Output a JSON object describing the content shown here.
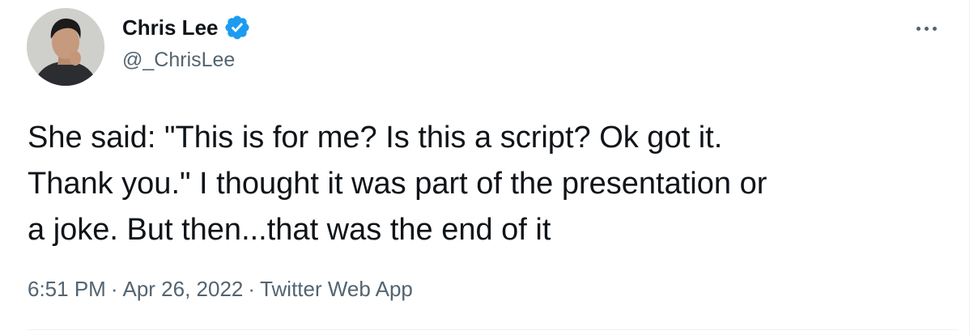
{
  "author": {
    "display_name": "Chris Lee",
    "handle": "@_ChrisLee",
    "verified": true,
    "avatar_icon": "profile-photo"
  },
  "menu": {
    "more_icon": "ellipsis-icon"
  },
  "tweet": {
    "text": "She said: \"This is for me? Is this a script? Ok got it.\nThank you.\" I thought it was part of the presentation or\na joke. But then...that was the end of it",
    "time": "6:51 PM",
    "separator": "·",
    "date": "Apr 26, 2022",
    "source": "Twitter Web App"
  },
  "colors": {
    "text_primary": "#0f1419",
    "text_secondary": "#536471",
    "verified_blue": "#1d9bf0",
    "divider": "#eff3f4"
  }
}
